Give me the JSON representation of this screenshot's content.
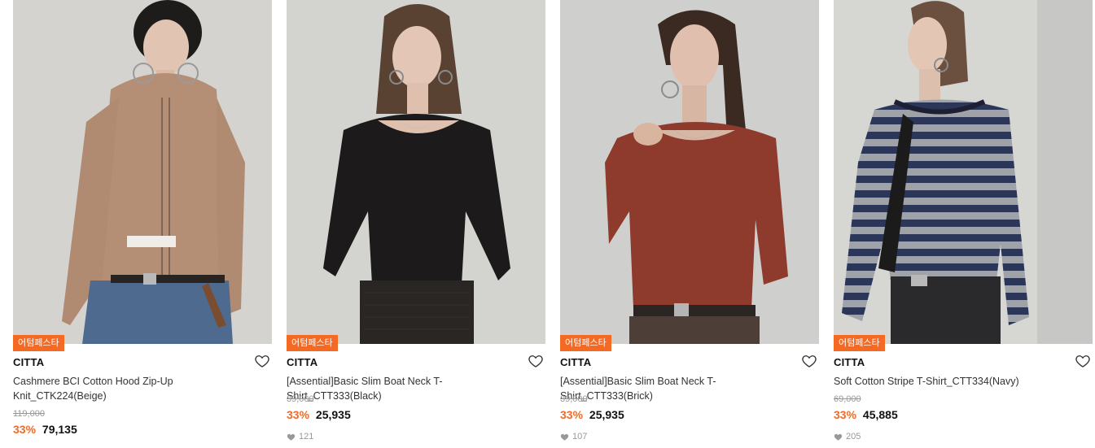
{
  "products": [
    {
      "badge": "어텀페스타",
      "brand": "CITTA",
      "name": "Cashmere BCI Cotton Hood Zip-Up Knit_CTK224(Beige)",
      "original_price": "119,000",
      "discount": "33%",
      "sale_price": "79,135",
      "likes": ""
    },
    {
      "badge": "어텀페스타",
      "brand": "CITTA",
      "name": "[Assential]Basic Slim Boat Neck T-Shirt_CTT333(Black)",
      "original_price": "39,000",
      "discount": "33%",
      "sale_price": "25,935",
      "likes": "121"
    },
    {
      "badge": "어텀페스타",
      "brand": "CITTA",
      "name": "[Assential]Basic Slim Boat Neck T-Shirt_CTT333(Brick)",
      "original_price": "39,000",
      "discount": "33%",
      "sale_price": "25,935",
      "likes": "107"
    },
    {
      "badge": "어텀페스타",
      "brand": "CITTA",
      "name": "Soft Cotton Stripe T-Shirt_CTT334(Navy)",
      "original_price": "69,000",
      "discount": "33%",
      "sale_price": "45,885",
      "likes": "205"
    }
  ],
  "icons": {
    "wishlist": "heart-outline-icon",
    "likes": "heart-filled-icon"
  },
  "colors": {
    "accent": "#f26a24",
    "badge_bg": "#f26a24",
    "muted": "#999999"
  }
}
